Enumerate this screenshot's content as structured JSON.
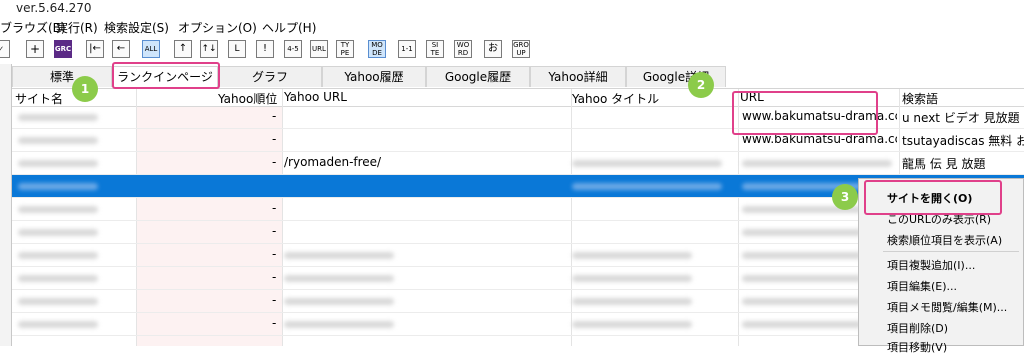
{
  "window": {
    "title": "ver.5.64.270"
  },
  "menu": [
    "ブラウズ(B)",
    "実行(R)",
    "検索設定(S)",
    "オプション(O)",
    "ヘルプ(H)"
  ],
  "toolbar": {
    "buttons": [
      "+",
      "GRC",
      "|←",
      "←",
      "ALL",
      "↑",
      "↑↓",
      "L",
      "!",
      "4-5",
      "URL",
      "TY PE",
      "MO DE",
      "1-1",
      "SI TE",
      "WO RD",
      "お",
      "GRO UP"
    ]
  },
  "tabs": [
    "標準",
    "ランクインページ",
    "グラフ",
    "Yahoo履歴",
    "Google履歴",
    "Yahoo詳細",
    "Google詳細"
  ],
  "columns": [
    "サイト名",
    "Yahoo順位",
    "Yahoo URL",
    "Yahoo タイトル",
    "URL",
    "検索語"
  ],
  "rows": [
    {
      "rank": "-",
      "yurl": "",
      "url": "www.bakumatsu-drama.cc",
      "kw": "u next ビデオ 見放題 中"
    },
    {
      "rank": "-",
      "yurl": "",
      "url": "www.bakumatsu-drama.cc",
      "kw": "tsutayadiscas 無料 お"
    },
    {
      "rank": "-",
      "yurl": "/ryomaden-free/",
      "url": "",
      "kw": "龍馬 伝 見 放題"
    },
    {
      "rank": "",
      "yurl": "",
      "url": "",
      "kw": ""
    },
    {
      "rank": "-",
      "yurl": "",
      "url": "",
      "kw": ""
    },
    {
      "rank": "-",
      "yurl": "",
      "url": "",
      "kw": ""
    },
    {
      "rank": "-",
      "yurl": "",
      "url": "",
      "kw": ""
    },
    {
      "rank": "-",
      "yurl": "",
      "url": "",
      "kw": ""
    },
    {
      "rank": "-",
      "yurl": "",
      "url": "",
      "kw": ""
    },
    {
      "rank": "-",
      "yurl": "",
      "url": "",
      "kw": ""
    }
  ],
  "context_menu": [
    "サイトを開く(O)",
    "このURLのみ表示(R)",
    "検索順位項目を表示(A)",
    "項目複製追加(I)...",
    "項目編集(E)...",
    "項目メモ閲覧/編集(M)...",
    "項目削除(D)",
    "項目移動(V)"
  ],
  "annotations": [
    "1",
    "2",
    "3"
  ],
  "colors": {
    "selection": "#0a78d7",
    "highlight": "#e0408a",
    "badge": "#8ccb4a"
  }
}
